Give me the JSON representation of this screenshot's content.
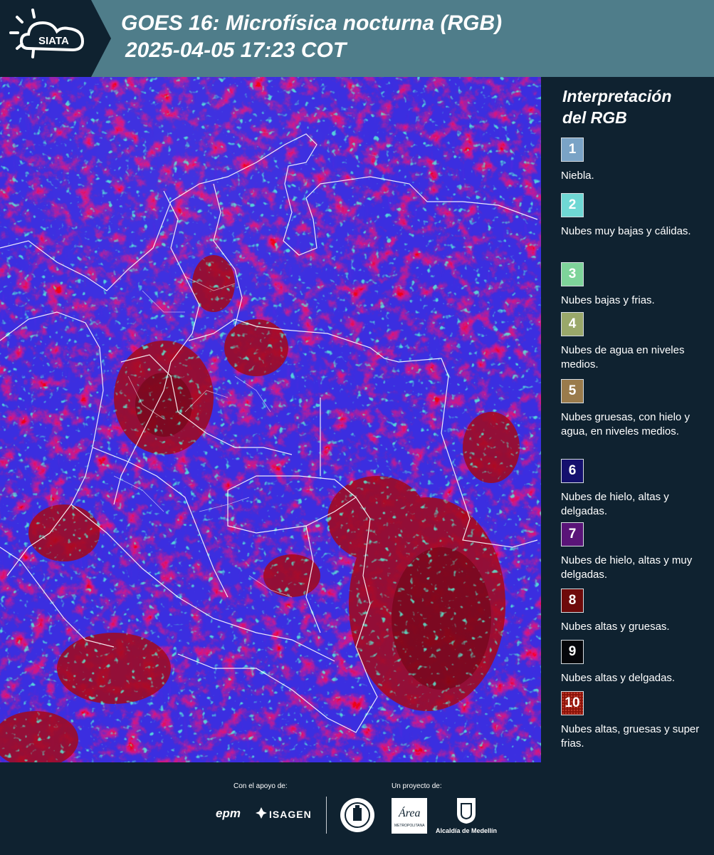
{
  "header": {
    "logo_text": "SIATA",
    "title_line1": "GOES 16: Microfísica nocturna (RGB)",
    "title_line2": "2025-04-05 17:23 COT"
  },
  "legend": {
    "title_line1": "Interpretación",
    "title_line2": "del RGB",
    "items": [
      {
        "number": "1",
        "label": "Niebla.",
        "color": "#7aa3c6"
      },
      {
        "number": "2",
        "label": "Nubes muy bajas y cálidas.",
        "color": "#6fd8d4"
      },
      {
        "number": "3",
        "label": "Nubes bajas y frias.",
        "color": "#7ed49a"
      },
      {
        "number": "4",
        "label": "Nubes de agua en niveles medios.",
        "color": "#9aa86a"
      },
      {
        "number": "5",
        "label": "Nubes gruesas, con hielo y agua, en niveles medios.",
        "color": "#9a7b4c"
      },
      {
        "number": "6",
        "label": "Nubes de hielo, altas y delgadas.",
        "color": "#14106e"
      },
      {
        "number": "7",
        "label": "Nubes de hielo, altas y muy delgadas.",
        "color": "#5a1478"
      },
      {
        "number": "8",
        "label": "Nubes altas y gruesas.",
        "color": "#6e0a0a"
      },
      {
        "number": "9",
        "label": "Nubes altas y delgadas.",
        "color": "#05060a"
      },
      {
        "number": "10",
        "label": "Nubes altas, gruesas y super frias.",
        "color": "#8a1208"
      }
    ]
  },
  "footer": {
    "support_caption": "Con el apoyo de:",
    "project_caption": "Un proyecto de:",
    "sponsor_epm": "epm",
    "sponsor_isagen": "ISAGEN",
    "area_logo_text": "Área",
    "area_logo_subtext": "METROPOLITANA",
    "alcaldia_text": "Alcaldía de Medellín"
  },
  "colors": {
    "header_bg": "#4f7d8a",
    "panel_bg": "#0f2230",
    "map_base": "#3a2bd8",
    "cloud_red": "#b00a1a",
    "border_lines": "#ffffff"
  }
}
